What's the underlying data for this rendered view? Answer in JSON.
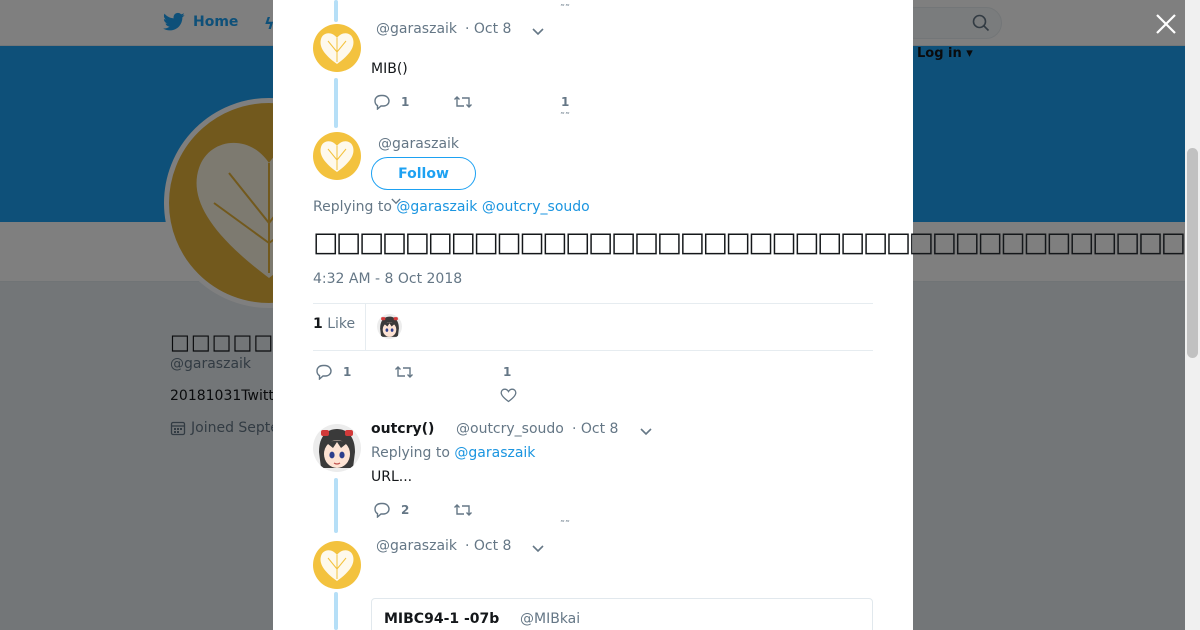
{
  "nav": {
    "home_label": "Home",
    "login_label": "Log in"
  },
  "profile": {
    "name": "□□□□□□",
    "handle": "@garaszaik",
    "bio": "20181031Twitt",
    "joined": "Joined Septe"
  },
  "tweet1": {
    "handle": "@garaszaik",
    "date": "· Oct 8",
    "text": "MIB()",
    "reply_count": "1",
    "like_count": "1"
  },
  "focus_tweet": {
    "handle": "@garaszaik",
    "follow_label": "Follow",
    "replying_label": "Replying to",
    "replying_to": [
      "@garaszaik",
      "@outcry_soudo"
    ],
    "text": "□□□□□□□□□□□□□□□□□□□□□□□□□□□□□□□□□□□□□□□□□□□□□□□□",
    "timestamp": "4:32 AM - 8 Oct 2018",
    "likes_number": "1",
    "likes_label": "Like",
    "reply_count": "1",
    "like_count": "1"
  },
  "tweet3": {
    "name": "outcry()",
    "handle": "@outcry_soudo",
    "date": "· Oct 8",
    "replying_label": "Replying to",
    "replying_to": "@garaszaik",
    "text": "URL...",
    "reply_count": "2"
  },
  "tweet4": {
    "handle": "@garaszaik",
    "date": "· Oct 8",
    "quoted_name": "MIBC94-1 -07b",
    "quoted_handle": "@MIBkai"
  },
  "colors": {
    "accent": "#1da1f2",
    "link": "#1b95e0",
    "thread": "#b6dff7",
    "heart": "#f3c23e"
  },
  "icons": [
    "twitter-bird-icon",
    "search-icon",
    "close-icon",
    "reply-icon",
    "retweet-icon",
    "heart-icon",
    "chevron-down-icon",
    "calendar-icon"
  ]
}
